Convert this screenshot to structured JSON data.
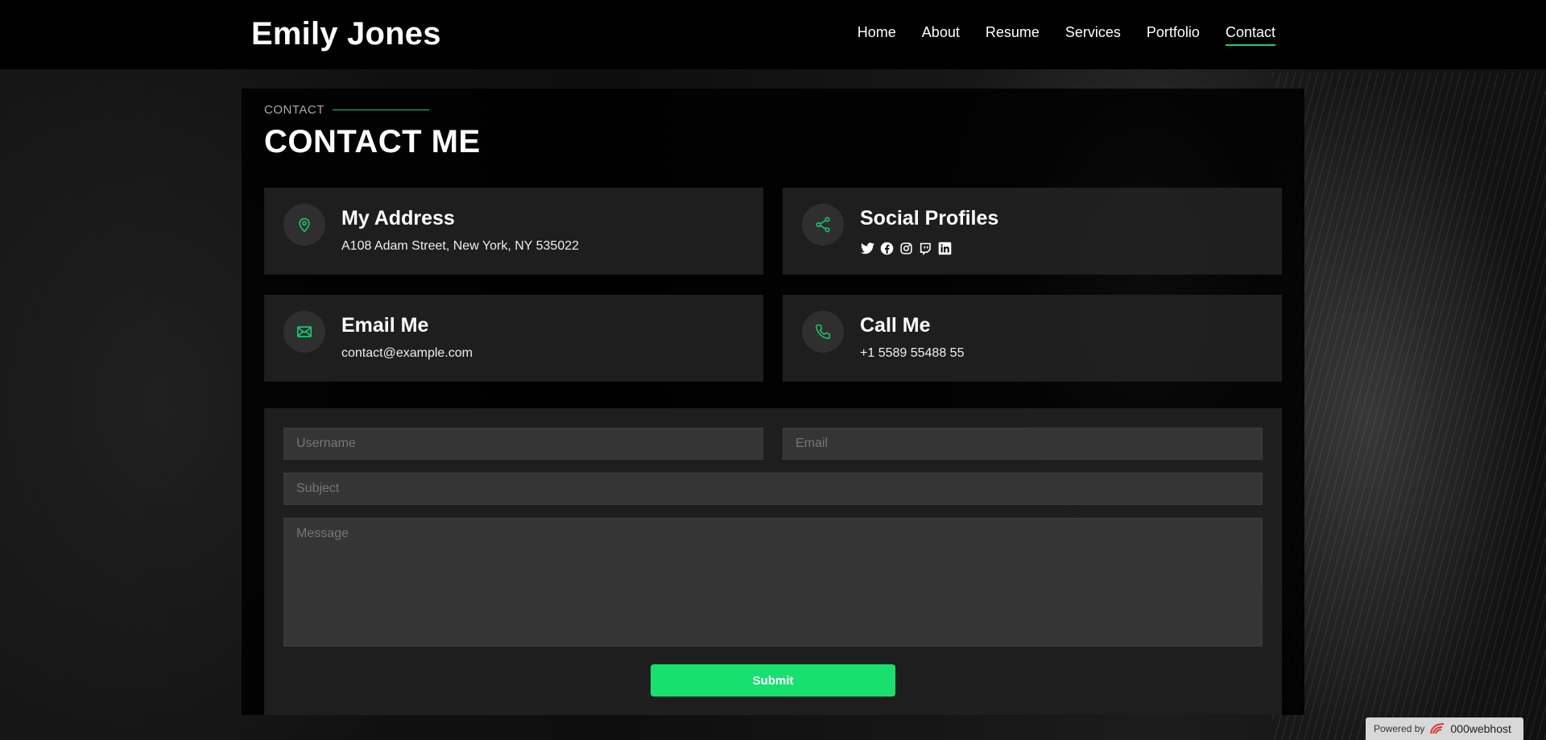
{
  "site": {
    "name": "Emily Jones"
  },
  "nav": {
    "items": [
      {
        "label": "Home"
      },
      {
        "label": "About"
      },
      {
        "label": "Resume"
      },
      {
        "label": "Services"
      },
      {
        "label": "Portfolio"
      },
      {
        "label": "Contact"
      }
    ],
    "active": "Contact"
  },
  "section": {
    "label": "CONTACT",
    "title": "CONTACT ME"
  },
  "cards": {
    "address": {
      "title": "My Address",
      "text": "A108 Adam Street, New York, NY 535022",
      "icon": "map-pin-icon"
    },
    "social": {
      "title": "Social Profiles",
      "icon": "share-icon",
      "profiles": [
        "twitter-icon",
        "facebook-icon",
        "instagram-icon",
        "twitch-icon",
        "linkedin-icon"
      ]
    },
    "email": {
      "title": "Email Me",
      "text": "contact@example.com",
      "icon": "envelope-icon"
    },
    "phone": {
      "title": "Call Me",
      "text": "+1 5589 55488 55",
      "icon": "phone-icon"
    }
  },
  "form": {
    "username_placeholder": "Username",
    "email_placeholder": "Email",
    "subject_placeholder": "Subject",
    "message_placeholder": "Message",
    "submit_label": "Submit"
  },
  "footer_badge": {
    "powered_by": "Powered by",
    "host": "000webhost"
  },
  "colors": {
    "accent": "#18d26e",
    "button": "#18e06e",
    "background": "#000000"
  }
}
